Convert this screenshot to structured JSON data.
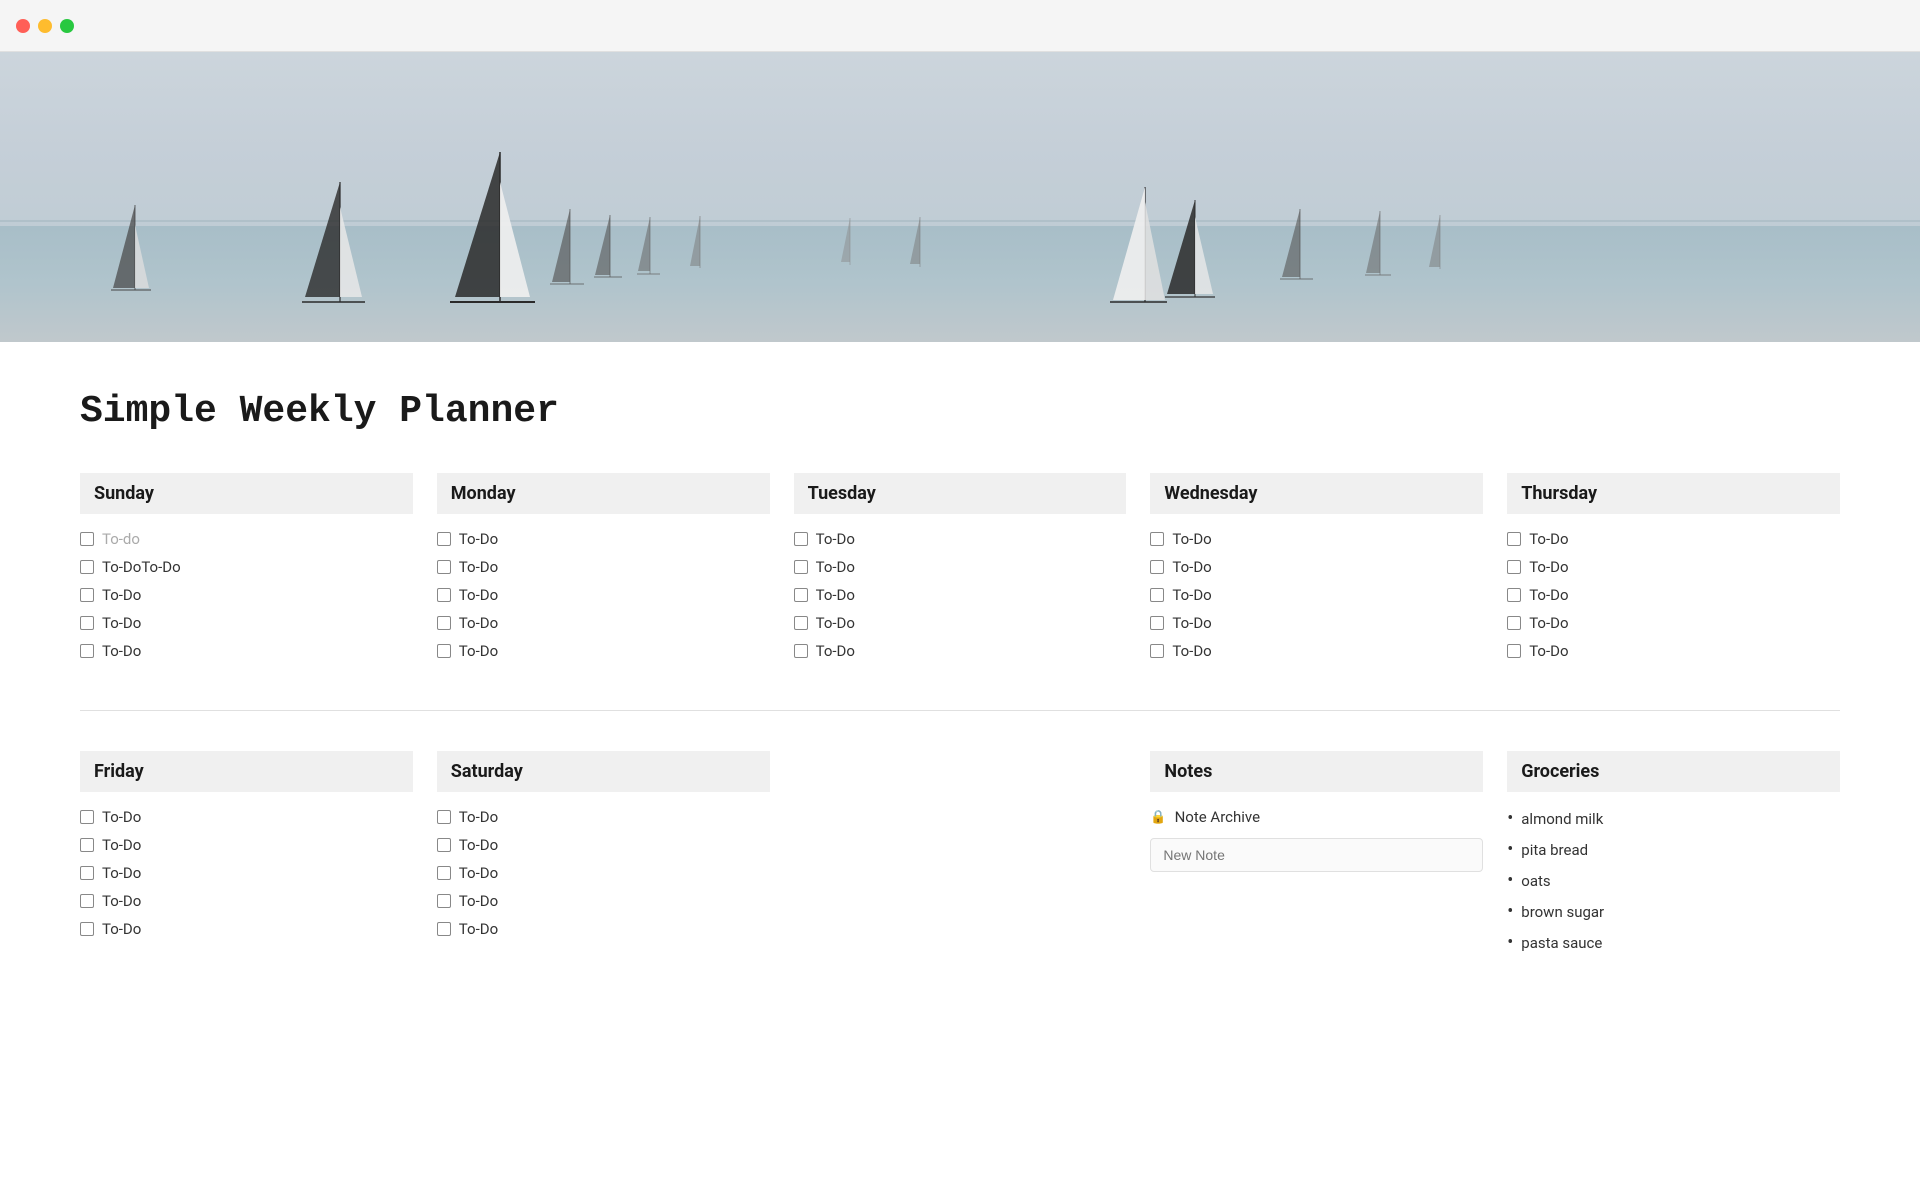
{
  "titlebar": {
    "close_label": "",
    "minimize_label": "",
    "maximize_label": ""
  },
  "page": {
    "title": "Simple Weekly Planner"
  },
  "days": [
    {
      "name": "Sunday",
      "items": [
        {
          "text": "To-do",
          "placeholder": true
        },
        {
          "text": "To-DoTo-Do",
          "placeholder": false
        },
        {
          "text": "To-Do",
          "placeholder": false
        },
        {
          "text": "To-Do",
          "placeholder": false
        },
        {
          "text": "To-Do",
          "placeholder": false
        }
      ]
    },
    {
      "name": "Monday",
      "items": [
        {
          "text": "To-Do",
          "placeholder": false
        },
        {
          "text": "To-Do",
          "placeholder": false
        },
        {
          "text": "To-Do",
          "placeholder": false
        },
        {
          "text": "To-Do",
          "placeholder": false
        },
        {
          "text": "To-Do",
          "placeholder": false
        }
      ]
    },
    {
      "name": "Tuesday",
      "items": [
        {
          "text": "To-Do",
          "placeholder": false
        },
        {
          "text": "To-Do",
          "placeholder": false
        },
        {
          "text": "To-Do",
          "placeholder": false
        },
        {
          "text": "To-Do",
          "placeholder": false
        },
        {
          "text": "To-Do",
          "placeholder": false
        }
      ]
    },
    {
      "name": "Wednesday",
      "items": [
        {
          "text": "To-Do",
          "placeholder": false
        },
        {
          "text": "To-Do",
          "placeholder": false
        },
        {
          "text": "To-Do",
          "placeholder": false
        },
        {
          "text": "To-Do",
          "placeholder": false
        },
        {
          "text": "To-Do",
          "placeholder": false
        }
      ]
    },
    {
      "name": "Thursday",
      "items": [
        {
          "text": "To-Do",
          "placeholder": false
        },
        {
          "text": "To-Do",
          "placeholder": false
        },
        {
          "text": "To-Do",
          "placeholder": false
        },
        {
          "text": "To-Do",
          "placeholder": false
        },
        {
          "text": "To-Do",
          "placeholder": false
        }
      ]
    }
  ],
  "bottom_days": [
    {
      "name": "Friday",
      "items": [
        {
          "text": "To-Do"
        },
        {
          "text": "To-Do"
        },
        {
          "text": "To-Do"
        },
        {
          "text": "To-Do"
        },
        {
          "text": "To-Do"
        }
      ]
    },
    {
      "name": "Saturday",
      "items": [
        {
          "text": "To-Do"
        },
        {
          "text": "To-Do"
        },
        {
          "text": "To-Do"
        },
        {
          "text": "To-Do"
        },
        {
          "text": "To-Do"
        }
      ]
    }
  ],
  "notes": {
    "header": "Notes",
    "archive_label": "Note Archive",
    "new_note_placeholder": "New Note"
  },
  "groceries": {
    "header": "Groceries",
    "items": [
      "almond milk",
      "pita bread",
      "oats",
      "brown sugar",
      "pasta sauce"
    ]
  }
}
